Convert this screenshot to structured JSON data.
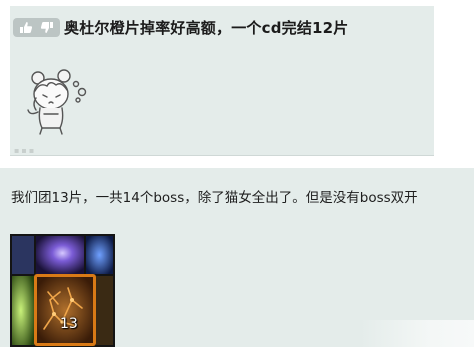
{
  "post1": {
    "title": "奥杜尔橙片掉率好高额，一个cd完结12片",
    "vote_icons": [
      "thumb-up-icon",
      "thumb-down-icon"
    ],
    "sticker": "chibi-girl-sticker"
  },
  "post2": {
    "text": "我们团13片，一共14个boss，除了猫女全出了。但是没有boss双开",
    "item_icon": "orange-shard-item-icon",
    "item_count": "13"
  },
  "colors": {
    "post_background": "#e4ecea",
    "vote_pill": "#bcc5c4"
  }
}
